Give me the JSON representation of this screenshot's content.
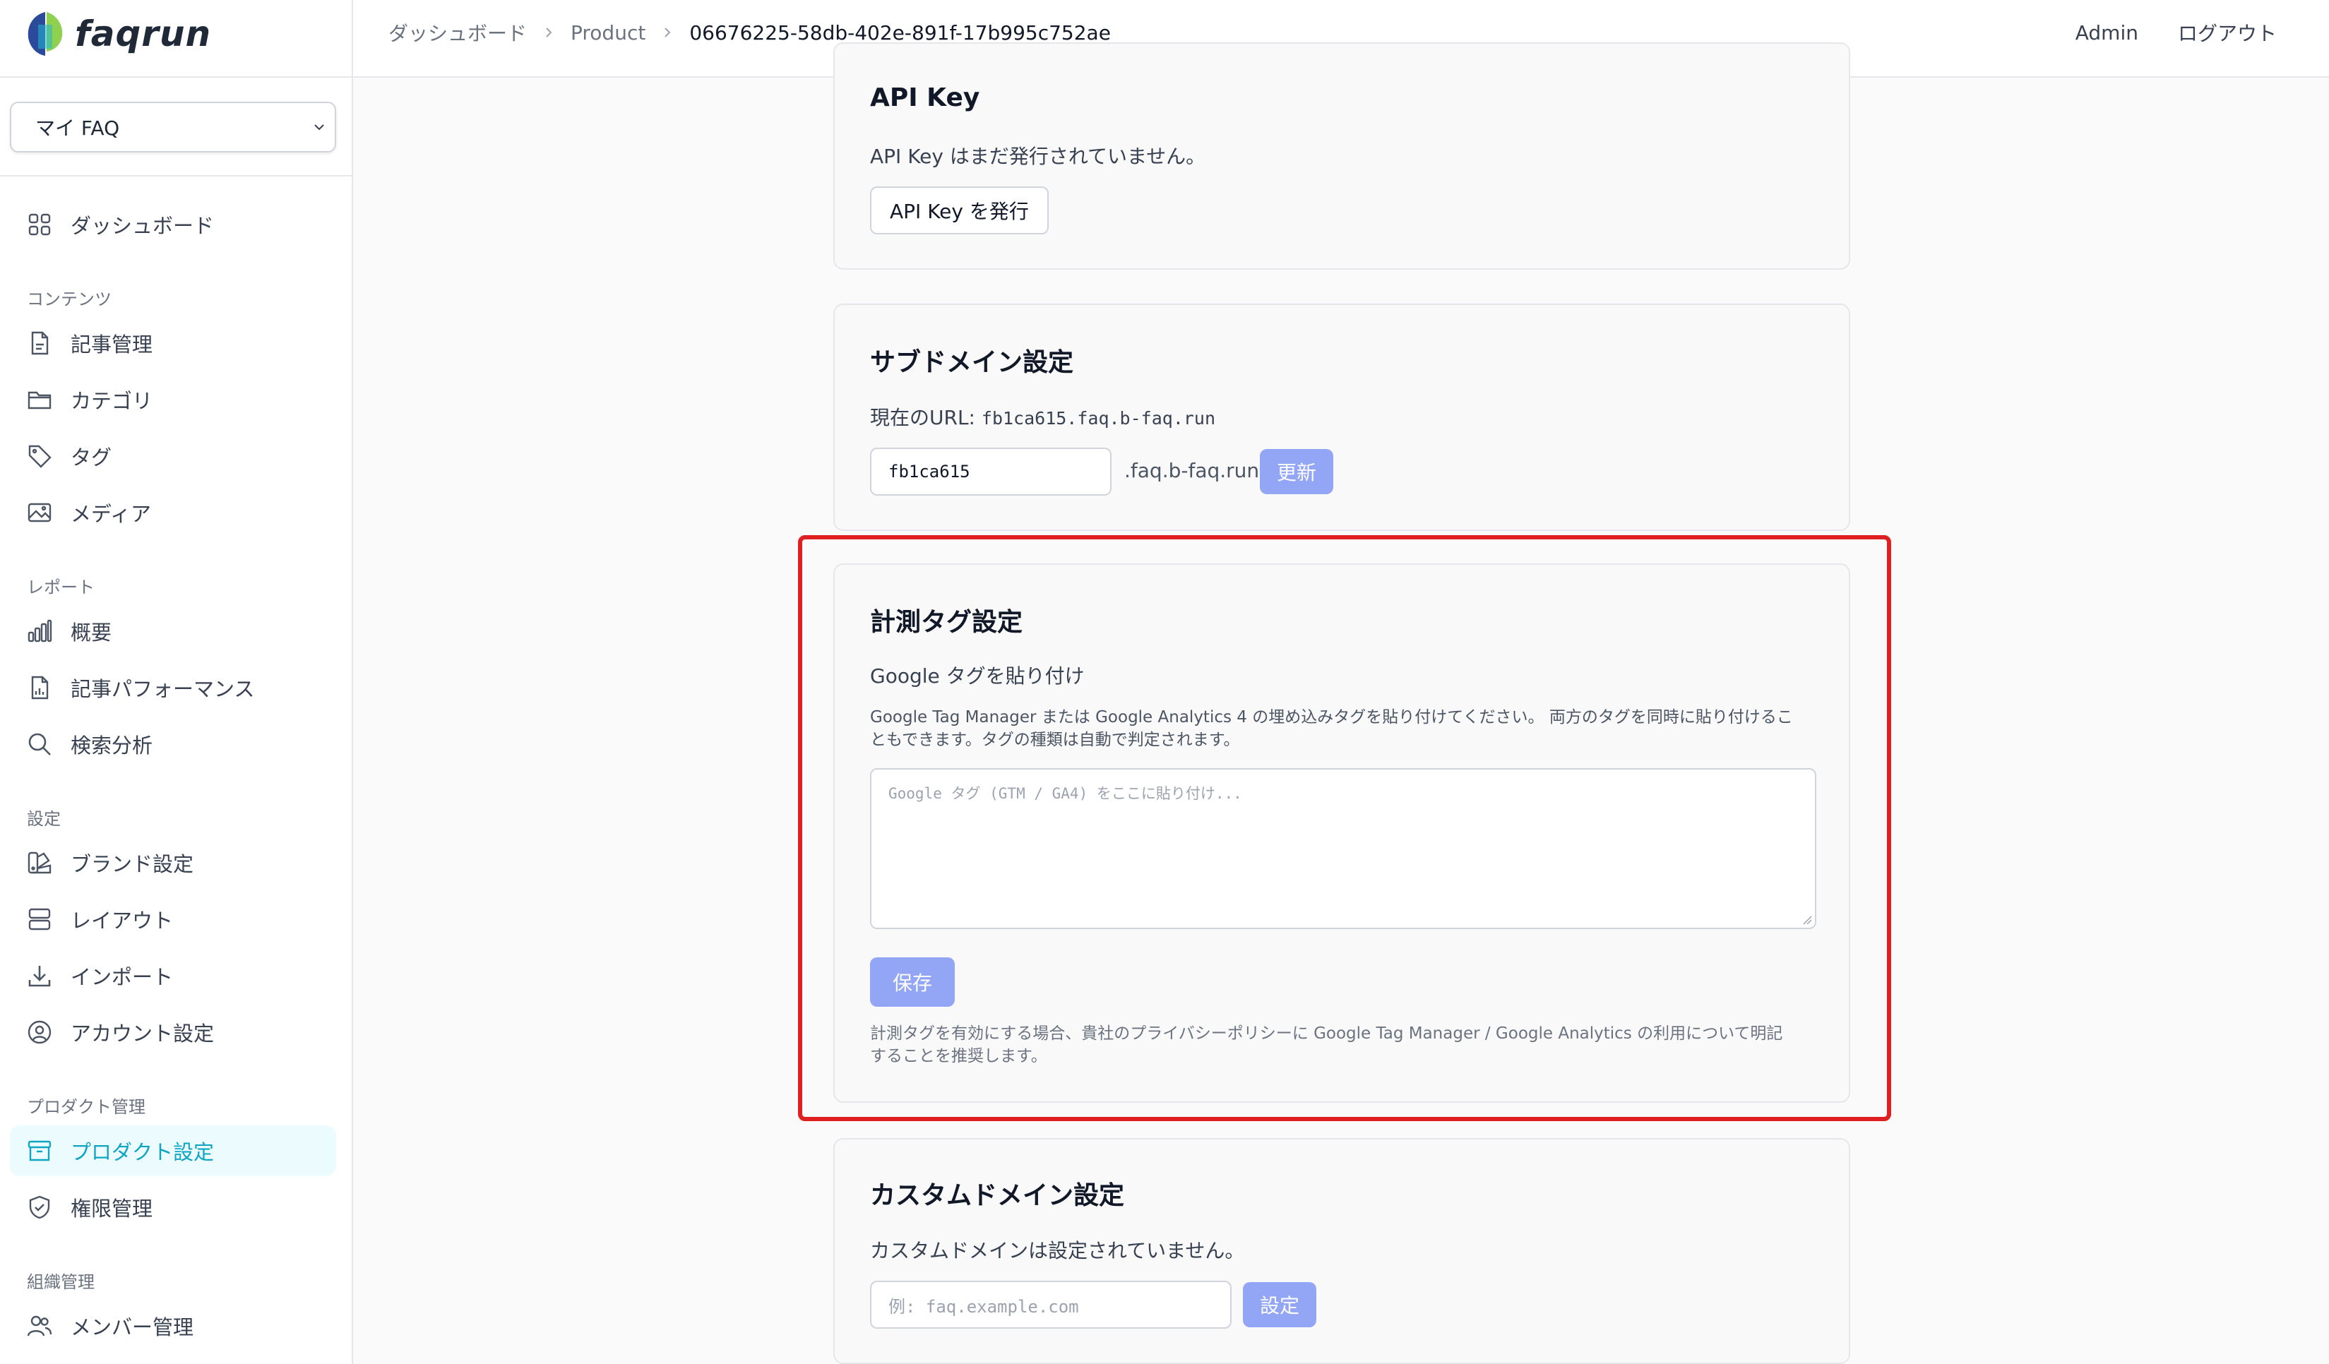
{
  "app": {
    "logo_text": "faqrun",
    "brand_color": "#0ea5c4"
  },
  "sidebar": {
    "faq_select": "マイ FAQ",
    "dashboard": "ダッシュボード",
    "sections": {
      "content": "コンテンツ",
      "report": "レポート",
      "settings": "設定",
      "product": "プロダクト管理",
      "org": "組織管理"
    },
    "items": {
      "articles": "記事管理",
      "categories": "カテゴリ",
      "tags": "タグ",
      "media": "メディア",
      "overview": "概要",
      "article_perf": "記事パフォーマンス",
      "search_analysis": "検索分析",
      "brand": "ブランド設定",
      "layout": "レイアウト",
      "import": "インポート",
      "account": "アカウント設定",
      "product_settings": "プロダクト設定",
      "permissions": "権限管理",
      "members": "メンバー管理"
    },
    "active_item": "product_settings"
  },
  "header": {
    "breadcrumb": [
      "ダッシュボード",
      "Product",
      "06676225-58db-402e-891f-17b995c752ae"
    ],
    "user": "Admin",
    "logout": "ログアウト"
  },
  "api_key": {
    "title": "API Key",
    "status": "API Key はまだ発行されていません。",
    "issue_button": "API Key を発行"
  },
  "subdomain": {
    "title": "サブドメイン設定",
    "current_url_label": "現在のURL: ",
    "current_url": "fb1ca615.faq.b-faq.run",
    "input_value": "fb1ca615",
    "suffix": ".faq.b-faq.run",
    "update_button": "更新"
  },
  "tracking": {
    "title": "計測タグ設定",
    "subtitle": "Google タグを貼り付け",
    "help_line1": "Google Tag Manager または Google Analytics 4 の埋め込みタグを貼り付けてください。 両方のタグを同時に貼り付けるこ",
    "help_line2": "ともできます。タグの種類は自動で判定されます。",
    "textarea_placeholder": "Google タグ (GTM / GA4) をここに貼り付け...",
    "save_button": "保存",
    "note_line1": "計測タグを有効にする場合、貴社のプライバシーポリシーに Google Tag Manager / Google Analytics の利用について明記",
    "note_line2": "することを推奨します。",
    "highlight_color": "#e02020"
  },
  "custom_domain": {
    "title": "カスタムドメイン設定",
    "status": "カスタムドメインは設定されていません。",
    "input_placeholder": "例: faq.example.com",
    "set_button": "設定"
  }
}
